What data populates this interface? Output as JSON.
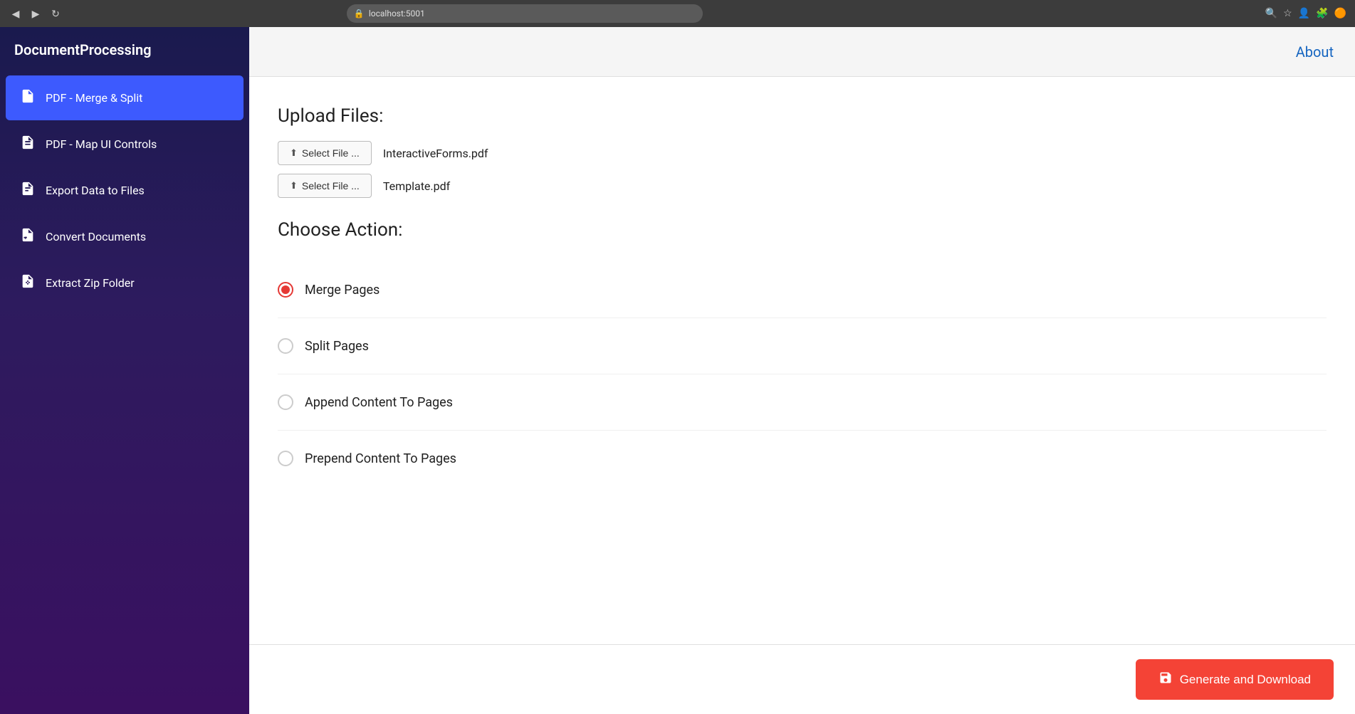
{
  "browser": {
    "url": "localhost:5001",
    "back_icon": "◀",
    "forward_icon": "▶",
    "refresh_icon": "↻",
    "lock_icon": "🔒"
  },
  "sidebar": {
    "title": "DocumentProcessing",
    "items": [
      {
        "id": "pdf-merge-split",
        "label": "PDF - Merge & Split",
        "icon": "📄",
        "active": true
      },
      {
        "id": "pdf-map-ui",
        "label": "PDF - Map UI Controls",
        "icon": "📋",
        "active": false
      },
      {
        "id": "export-data",
        "label": "Export Data to Files",
        "icon": "📊",
        "active": false
      },
      {
        "id": "convert-docs",
        "label": "Convert Documents",
        "icon": "📁",
        "active": false
      },
      {
        "id": "extract-zip",
        "label": "Extract Zip Folder",
        "icon": "🗂",
        "active": false
      }
    ]
  },
  "header": {
    "about_label": "About"
  },
  "content": {
    "upload_section_title": "Upload Files:",
    "files": [
      {
        "btn_label": "Select File ...",
        "file_name": "InteractiveForms.pdf"
      },
      {
        "btn_label": "Select File ...",
        "file_name": "Template.pdf"
      }
    ],
    "action_section_title": "Choose Action:",
    "actions": [
      {
        "id": "merge-pages",
        "label": "Merge Pages",
        "selected": true
      },
      {
        "id": "split-pages",
        "label": "Split Pages",
        "selected": false
      },
      {
        "id": "append-content",
        "label": "Append Content To Pages",
        "selected": false
      },
      {
        "id": "prepend-content",
        "label": "Prepend Content To Pages",
        "selected": false
      }
    ]
  },
  "footer": {
    "generate_btn_label": "Generate and Download",
    "generate_btn_icon": "💾"
  }
}
